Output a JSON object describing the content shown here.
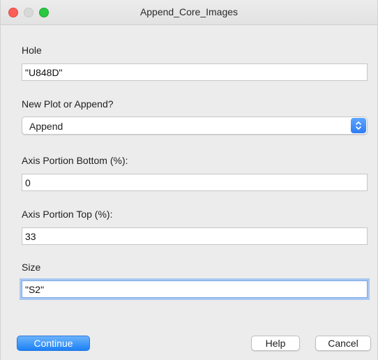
{
  "window": {
    "title": "Append_Core_Images"
  },
  "form": {
    "hole": {
      "label": "Hole",
      "value": "\"U848D\""
    },
    "mode": {
      "label": "New Plot or Append?",
      "selected": "Append"
    },
    "axis_bottom": {
      "label": "Axis Portion Bottom (%):",
      "value": "0"
    },
    "axis_top": {
      "label": "Axis Portion Top (%):",
      "value": "33"
    },
    "size": {
      "label": "Size",
      "value": "\"S2\""
    }
  },
  "buttons": {
    "continue": "Continue",
    "help": "Help",
    "cancel": "Cancel"
  },
  "colors": {
    "accent": "#1c81f6",
    "close": "#fc5f57",
    "maximize": "#28c840",
    "focus_ring": "#a8c8f2"
  }
}
